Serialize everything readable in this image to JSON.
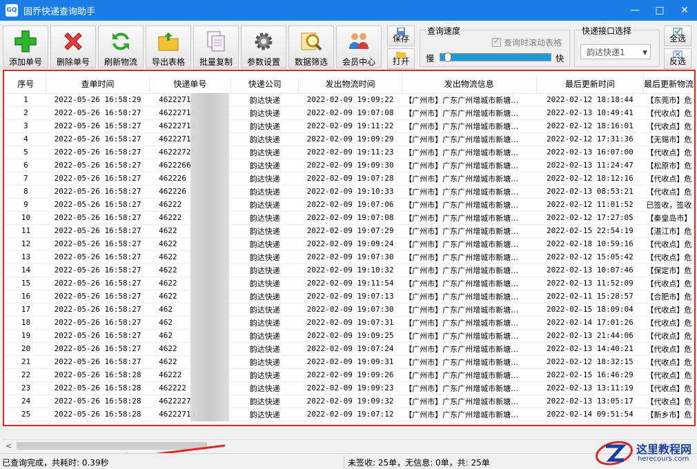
{
  "window": {
    "title": "固乔快递查询助手",
    "icon_text": "GQ",
    "controls": [
      "—",
      "□",
      "✕"
    ]
  },
  "toolbar": {
    "buttons": [
      {
        "label": "添加单号",
        "icon": "plus-icon"
      },
      {
        "label": "删除单号",
        "icon": "delete-x-icon"
      },
      {
        "label": "刷新物流",
        "icon": "refresh-icon"
      },
      {
        "label": "导出表格",
        "icon": "export-folder-icon"
      },
      {
        "label": "批量复制",
        "icon": "copy-icon"
      },
      {
        "label": "参数设置",
        "icon": "gear-icon"
      },
      {
        "label": "数据筛选",
        "icon": "search-filter-icon"
      },
      {
        "label": "会员中心",
        "icon": "users-icon"
      }
    ],
    "save_label": "保存",
    "open_label": "打开",
    "speed_group": {
      "title": "查询速度",
      "scroll_checkbox_label": "查询时滚动表格",
      "slow_label": "慢",
      "fast_label": "快",
      "speed_level": 0.04
    },
    "api_group": {
      "title": "快递接口选择",
      "selected": "韵达快递1"
    },
    "select_all_label": "全选",
    "invert_label": "反选"
  },
  "table": {
    "columns": [
      "序号",
      "查单时间",
      "快递单号",
      "快递公司",
      "发出物流时间",
      "发出物流信息",
      "最后更新时间",
      "最后更新物流"
    ],
    "rows": [
      {
        "no": "1",
        "query_time": "2022-05-26 16:58:29",
        "tracking": "4622271€",
        "company": "韵达快递",
        "ship_time": "2022-02-09 19:09:22",
        "ship_info": "【广州市】广东广州增城市新塘…",
        "last_time": "2022-02-12 18:18:44",
        "last_info": "【东莞市】危"
      },
      {
        "no": "2",
        "query_time": "2022-05-26 16:58:27",
        "tracking": "46222714",
        "company": "韵达快递",
        "ship_time": "2022-02-09 19:07:08",
        "ship_info": "【广州市】广东广州增城市新塘…",
        "last_time": "2022-02-13 10:49:41",
        "last_info": "【代收点】危"
      },
      {
        "no": "3",
        "query_time": "2022-05-26 16:58:27",
        "tracking": "46222719",
        "company": "韵达快递",
        "ship_time": "2022-02-09 19:11:22",
        "ship_info": "【广州市】广东广州增城市新塘…",
        "last_time": "2022-02-12 18:16:01",
        "last_info": "【代收点】危"
      },
      {
        "no": "4",
        "query_time": "2022-05-26 16:58:27",
        "tracking": "46222719",
        "company": "韵达快递",
        "ship_time": "2022-02-09 19:09:29",
        "ship_info": "【广州市】广东广州增城市新塘…",
        "last_time": "2022-02-12 17:31:36",
        "last_info": "【无锡市】危"
      },
      {
        "no": "5",
        "query_time": "2022-05-26 16:58:27",
        "tracking": "4622272!",
        "company": "韵达快递",
        "ship_time": "2022-02-09 19:11:23",
        "ship_info": "【广州市】广东广州增城市新塘…",
        "last_time": "2022-02-13 16:07:00",
        "last_info": "【代收点】危"
      },
      {
        "no": "6",
        "query_time": "2022-05-26 16:58:27",
        "tracking": "4622266",
        "company": "韵达快递",
        "ship_time": "2022-02-09 19:09:30",
        "ship_info": "【广州市】广东广州增城市新塘…",
        "last_time": "2022-02-13 11:24:47",
        "last_info": "【松原市】危"
      },
      {
        "no": "7",
        "query_time": "2022-05-26 16:58:27",
        "tracking": "462226",
        "company": "韵达快递",
        "ship_time": "2022-02-09 19:07:28",
        "ship_info": "【广州市】广东广州增城市新塘…",
        "last_time": "2022-02-12 18:12:16",
        "last_info": "【代收点】危"
      },
      {
        "no": "8",
        "query_time": "2022-05-26 16:58:27",
        "tracking": "462226",
        "company": "韵达快递",
        "ship_time": "2022-02-09 19:10:33",
        "ship_info": "【广州市】广东广州增城市新塘…",
        "last_time": "2022-02-13 08:53:21",
        "last_info": "【代收点】危"
      },
      {
        "no": "9",
        "query_time": "2022-05-26 16:58:27",
        "tracking": "46222",
        "company": "韵达快递",
        "ship_time": "2022-02-09 19:07:06",
        "ship_info": "【广州市】广东广州增城市新塘…",
        "last_time": "2022-02-12 11:01:52",
        "last_info": "已签收，签收"
      },
      {
        "no": "10",
        "query_time": "2022-05-26 16:58:27",
        "tracking": "46222",
        "company": "韵达快递",
        "ship_time": "2022-02-09 19:07:08",
        "ship_info": "【广州市】广东广州增城市新塘…",
        "last_time": "2022-02-12 17:27:05",
        "last_info": "【秦皇岛市】"
      },
      {
        "no": "11",
        "query_time": "2022-05-26 16:58:27",
        "tracking": "4622",
        "company": "韵达快递",
        "ship_time": "2022-02-09 19:07:29",
        "ship_info": "【广州市】广东广州增城市新塘…",
        "last_time": "2022-02-15 22:54:19",
        "last_info": "【湛江市】危"
      },
      {
        "no": "12",
        "query_time": "2022-05-26 16:58:27",
        "tracking": "4622",
        "company": "韵达快递",
        "ship_time": "2022-02-09 19:09:24",
        "ship_info": "【广州市】广东广州增城市新塘…",
        "last_time": "2022-02-18 10:59:16",
        "last_info": "【代收点】危"
      },
      {
        "no": "13",
        "query_time": "2022-05-26 16:58:27",
        "tracking": "4622",
        "company": "韵达快递",
        "ship_time": "2022-02-09 19:07:30",
        "ship_info": "【广州市】广东广州增城市新塘…",
        "last_time": "2022-02-12 15:05:42",
        "last_info": "【代收点】危"
      },
      {
        "no": "14",
        "query_time": "2022-05-26 16:58:27",
        "tracking": "4622",
        "company": "韵达快递",
        "ship_time": "2022-02-09 19:10:32",
        "ship_info": "【广州市】广东广州增城市新塘…",
        "last_time": "2022-02-13 10:07:46",
        "last_info": "【保定市】危"
      },
      {
        "no": "15",
        "query_time": "2022-05-26 16:58:27",
        "tracking": "4622",
        "company": "韵达快递",
        "ship_time": "2022-02-09 19:11:54",
        "ship_info": "【广州市】广东广州增城市新塘…",
        "last_time": "2022-02-13 11:52:09",
        "last_info": "【代收点】危"
      },
      {
        "no": "16",
        "query_time": "2022-05-26 16:58:27",
        "tracking": "4622",
        "company": "韵达快递",
        "ship_time": "2022-02-09 19:07:13",
        "ship_info": "【广州市】广东广州增城市新塘…",
        "last_time": "2022-02-11 15:28:57",
        "last_info": "【合肥市】危"
      },
      {
        "no": "17",
        "query_time": "2022-05-26 16:58:27",
        "tracking": "462",
        "company": "韵达快递",
        "ship_time": "2022-02-09 19:07:30",
        "ship_info": "【广州市】广东广州增城市新塘…",
        "last_time": "2022-02-15 18:09:04",
        "last_info": "【代收点】危"
      },
      {
        "no": "18",
        "query_time": "2022-05-26 16:58:27",
        "tracking": "462",
        "company": "韵达快递",
        "ship_time": "2022-02-09 19:07:31",
        "ship_info": "【广州市】广东广州增城市新塘…",
        "last_time": "2022-02-14 17:01:26",
        "last_info": "【代收点】危"
      },
      {
        "no": "19",
        "query_time": "2022-05-26 16:58:27",
        "tracking": "462",
        "company": "韵达快递",
        "ship_time": "2022-02-09 19:09:25",
        "ship_info": "【广州市】广东广州增城市新塘…",
        "last_time": "2022-02-13 21:44:06",
        "last_info": "【代收点】危"
      },
      {
        "no": "20",
        "query_time": "2022-05-26 16:58:27",
        "tracking": "4622",
        "company": "韵达快递",
        "ship_time": "2022-02-09 19:07:24",
        "ship_info": "【广州市】广东广州增城市新塘…",
        "last_time": "2022-02-13 14:40:21",
        "last_info": "【代收点】危"
      },
      {
        "no": "21",
        "query_time": "2022-05-26 16:58:27",
        "tracking": "4622",
        "company": "韵达快递",
        "ship_time": "2022-02-09 19:09:31",
        "ship_info": "【广州市】广东广州增城市新塘…",
        "last_time": "2022-02-12 18:32:15",
        "last_info": "【代收点】危"
      },
      {
        "no": "22",
        "query_time": "2022-05-26 16:58:28",
        "tracking": "46222",
        "company": "韵达快递",
        "ship_time": "2022-02-09 19:09:26",
        "ship_info": "【广州市】广东广州增城市新塘…",
        "last_time": "2022-02-15 16:46:29",
        "last_info": "【代收点】危"
      },
      {
        "no": "23",
        "query_time": "2022-05-26 16:58:28",
        "tracking": "462222",
        "company": "韵达快递",
        "ship_time": "2022-02-09 19:09:23",
        "ship_info": "【广州市】广东广州增城市新塘…",
        "last_time": "2022-02-13 13:11:19",
        "last_info": "【代收点】危"
      },
      {
        "no": "24",
        "query_time": "2022-05-26 16:58:28",
        "tracking": "4622227",
        "company": "韵达快递",
        "ship_time": "2022-02-09 19:09:32",
        "ship_info": "【广州市】广东广州增城市新塘…",
        "last_time": "2022-02-13 13:05:17",
        "last_info": "【代收点】危"
      },
      {
        "no": "25",
        "query_time": "2022-05-26 16:58:28",
        "tracking": "46222713",
        "company": "韵达快递",
        "ship_time": "2022-02-09 19:07:12",
        "ship_info": "【广州市】广东广州增城市新塘…",
        "last_time": "2022-02-14 09:51:54",
        "last_info": "【新乡市】危"
      }
    ]
  },
  "scrollbar": {
    "left_arrow": "<"
  },
  "status": {
    "left": "已查询完成，共耗时: 0.39秒",
    "right": "未签收: 25单，无信息: 0单，共: 25单"
  },
  "watermark": {
    "title": "这里教程网",
    "sub": "herecours.com"
  },
  "colors": {
    "titlebar": "#1a7ee6",
    "highlight_border": "#e52222",
    "slider_fill": "#1e9bd7",
    "arrow": "#e52222"
  }
}
